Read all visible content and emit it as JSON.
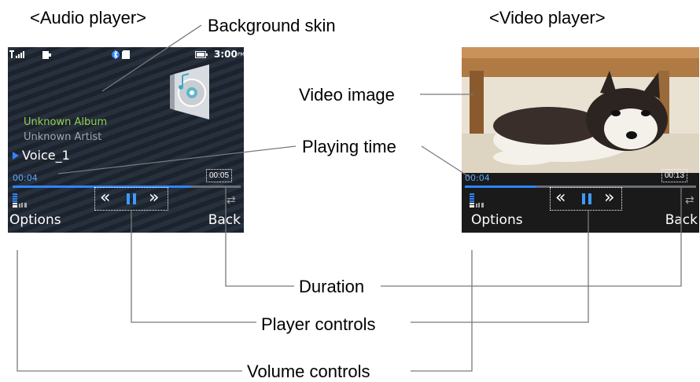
{
  "titles": {
    "audio": "<Audio player>",
    "video": "<Video player>"
  },
  "callouts": {
    "background_skin": "Background skin",
    "video_image": "Video image",
    "playing_time": "Playing time",
    "duration": "Duration",
    "player_controls": "Player controls",
    "volume_controls": "Volume controls"
  },
  "audio_screen": {
    "status_time": "3:00",
    "status_ampm": "PM",
    "album": "Unknown Album",
    "artist": "Unknown Artist",
    "track": "Voice_1",
    "elapsed": "00:04",
    "duration": "00:05",
    "progress": 0.78,
    "left_softkey": "Options",
    "right_softkey": "Back",
    "rewind_icon": "«",
    "forward_icon": "»",
    "colors": {
      "album": "#8fd14f",
      "artist": "#a0a8b0",
      "accent": "#2f86ff"
    }
  },
  "video_screen": {
    "elapsed": "00:04",
    "duration": "00:13",
    "progress": 0.31,
    "left_softkey": "Options",
    "right_softkey": "Back",
    "rewind_icon": "«",
    "forward_icon": "»"
  }
}
